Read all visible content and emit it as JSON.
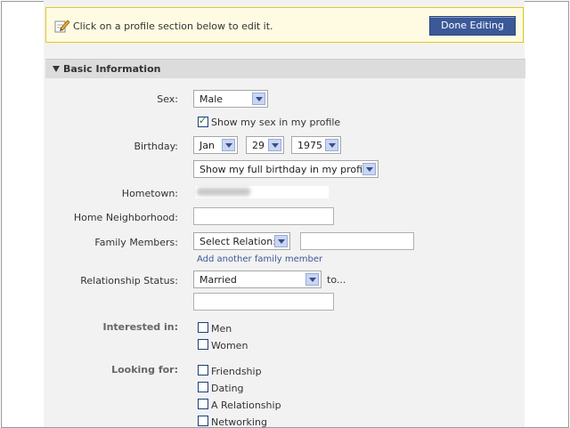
{
  "notice": {
    "message": "Click on a profile section below to edit it.",
    "done_label": "Done Editing"
  },
  "section": {
    "title": "Basic Information"
  },
  "sex": {
    "label": "Sex:",
    "value": "Male",
    "show_label": "Show my sex in my profile",
    "show_checked": true
  },
  "birthday": {
    "label": "Birthday:",
    "month": "Jan",
    "day": "29",
    "year": "1975",
    "visibility": "Show my full birthday in my profile."
  },
  "hometown": {
    "label": "Hometown:",
    "value": ""
  },
  "neighborhood": {
    "label": "Home Neighborhood:",
    "value": ""
  },
  "family": {
    "label": "Family Members:",
    "relation": "Select Relation:",
    "name_value": "",
    "add_link": "Add another family member"
  },
  "relationship": {
    "label": "Relationship Status:",
    "value": "Married",
    "to_label": "to...",
    "partner_value": ""
  },
  "interested": {
    "label": "Interested in:",
    "options": [
      "Men",
      "Women"
    ]
  },
  "looking": {
    "label": "Looking for:",
    "options": [
      "Friendship",
      "Dating",
      "A Relationship",
      "Networking"
    ]
  },
  "icons": {
    "notice_icon": "pencil-icon",
    "collapse_icon": "triangle-down-icon"
  },
  "colors": {
    "button_bg": "#3b5998",
    "notice_bg": "#fffbe2",
    "notice_border": "#e2c822",
    "link": "#3b5998"
  }
}
